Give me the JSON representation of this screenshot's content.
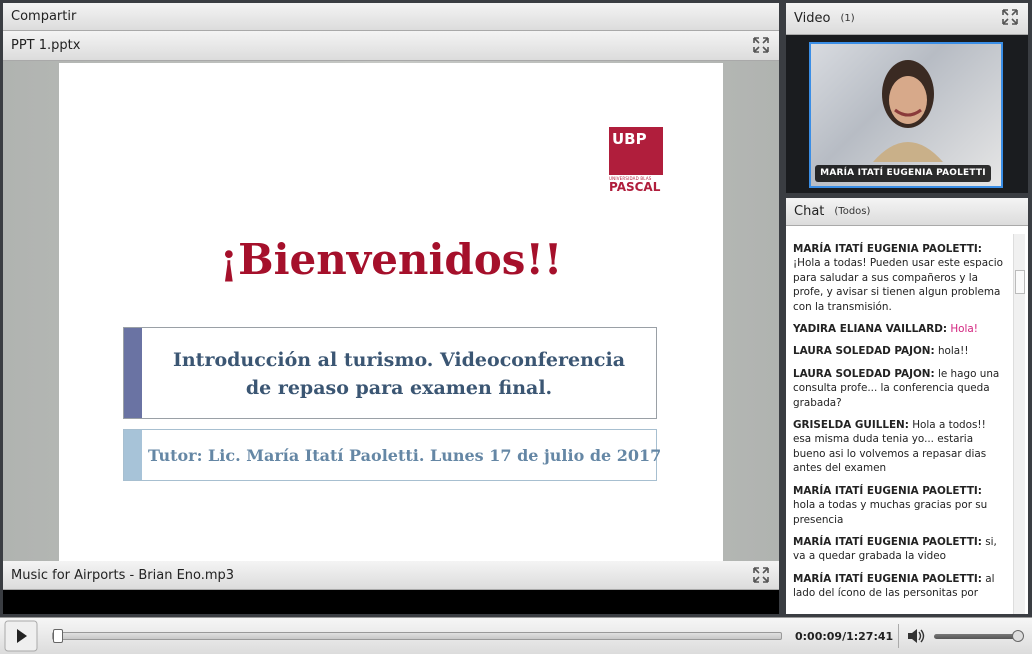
{
  "share_pod": {
    "title": "Compartir"
  },
  "ppt_pod": {
    "title": "PPT 1.pptx"
  },
  "slide": {
    "logo_text": "UBP",
    "logo_sub1": "UNIVERSIDAD BLAS",
    "logo_sub2": "PASCAL",
    "heading": "¡Bienvenidos!!",
    "subtitle_line1": "Introducción al turismo. Videoconferencia",
    "subtitle_line2": "de repaso para examen final.",
    "tutor_line": "Tutor: Lic. María Itatí Paoletti. Lunes 17 de julio de 2017"
  },
  "music_pod": {
    "title": "Music for Airports - Brian Eno.mp3"
  },
  "video_pod": {
    "title": "Video",
    "count": "(1)",
    "participant_name": "MARÍA ITATÍ EUGENIA PAOLETTI"
  },
  "chat_pod": {
    "title": "Chat",
    "audience": "(Todos)",
    "messages": [
      {
        "author": "MARÍA ITATÍ EUGENIA PAOLETTI:",
        "text": "¡Hola a todas! Pueden usar este espacio para saludar a sus compañeros y la profe, y avisar si tienen algun problema con la transmisión."
      },
      {
        "author": "YADIRA ELIANA VAILLARD:",
        "text": "Hola!"
      },
      {
        "author": "LAURA SOLEDAD PAJON:",
        "text": "hola!!"
      },
      {
        "author": "LAURA SOLEDAD PAJON:",
        "text": "le hago una consulta profe... la conferencia queda grabada?"
      },
      {
        "author": "GRISELDA GUILLEN:",
        "text": "Hola a todos!! esa misma duda tenia yo... estaria bueno asi lo volvemos a repasar dias antes del examen"
      },
      {
        "author": "MARÍA ITATÍ EUGENIA PAOLETTI:",
        "text": "hola a todas y muchas gracias por su presencia"
      },
      {
        "author": "MARÍA ITATÍ EUGENIA PAOLETTI:",
        "text": "si, va a quedar grabada la video"
      },
      {
        "author": "MARÍA ITATÍ EUGENIA PAOLETTI:",
        "text": "al lado del ícono de las personitas por"
      }
    ]
  },
  "player": {
    "time": "0:00:09/1:27:41",
    "progress_fraction": 0.002,
    "volume_fraction": 0.98
  },
  "colors": {
    "accent_red": "#a5102b",
    "chat_highlight": "#d3247f",
    "video_border": "#3a8ee6"
  }
}
